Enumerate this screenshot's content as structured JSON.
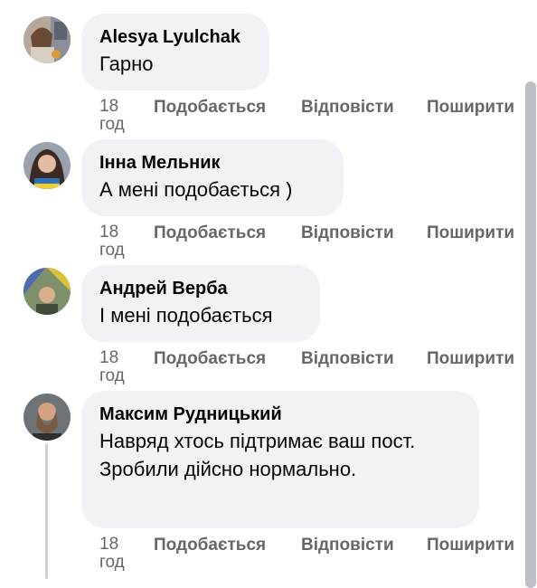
{
  "comments": [
    {
      "author": "Alesya Lyulchak",
      "text": "Гарно",
      "time": "18 год",
      "avatar_icon": "user-photo-icon",
      "actions": {
        "like": "Подобається",
        "reply": "Відповісти",
        "share": "Поширити"
      }
    },
    {
      "author": "Інна Мельник",
      "text": "А мені подобається )",
      "time": "18 год",
      "avatar_icon": "user-photo-icon",
      "actions": {
        "like": "Подобається",
        "reply": "Відповісти",
        "share": "Поширити"
      }
    },
    {
      "author": "Андрей Верба",
      "text": "І мені подобається",
      "time": "18 год",
      "avatar_icon": "user-photo-icon",
      "actions": {
        "like": "Подобається",
        "reply": "Відповісти",
        "share": "Поширити"
      }
    },
    {
      "author": "Максим Рудницький",
      "text": "Навряд хтось підтримає ваш пост. Зробили дійсно нормально.",
      "time": "18 год",
      "avatar_icon": "user-photo-icon",
      "actions": {
        "like": "Подобається",
        "reply": "Відповісти",
        "share": "Поширити"
      }
    }
  ],
  "colors": {
    "bubble": "#f0f2f5",
    "meta_text": "#65676b",
    "text": "#050505"
  }
}
